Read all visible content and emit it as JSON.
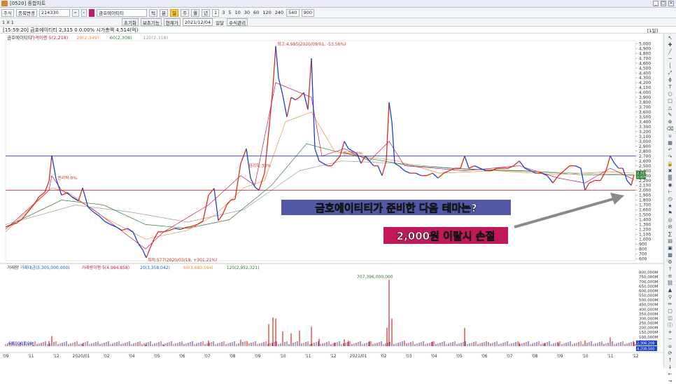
{
  "window": {
    "title": "[0520] 종합차트"
  },
  "toolbar1": {
    "market_sel": "주식",
    "sort_sel": "종목변경",
    "code": "214330",
    "stock_name": "금호에이티티",
    "period_tabs": [
      "틱",
      "분",
      "일",
      "주",
      "월",
      "년"
    ],
    "intervals": [
      "1",
      "3",
      "5",
      "10",
      "30",
      "60",
      "120",
      "240"
    ],
    "count_a": "540",
    "count_b": "900"
  },
  "toolbar2": {
    "ratio": "1 X 1",
    "btn_a": "초기화",
    "btn_b": "보조기능",
    "btn_c": "현재가",
    "date": "2021/12/04",
    "check_label": "일달",
    "btn_d": "수식관리"
  },
  "info": {
    "text": "[15:59:20] 금호에이티티 2,315   0 0.00% 시가총액 4,514(억)",
    "period": "[1일]"
  },
  "chart_data": {
    "type": "line",
    "title": "",
    "price_legend": [
      {
        "name": "금호에이티티",
        "color": "#333333"
      },
      {
        "name": "가격이평 5(2,218)",
        "color": "#c2185b"
      },
      {
        "name": "20(2,349)",
        "color": "#e69138"
      },
      {
        "name": "60(2,308)",
        "color": "#2e7d32"
      },
      {
        "name": "120(2,318)",
        "color": "#9e9e9e"
      }
    ],
    "volume_legend": [
      {
        "name": "거래량",
        "color": "#333333"
      },
      {
        "name": "거래대금(5,305,000,000)",
        "color": "#1565c0"
      },
      {
        "name": "거래량이평 5(4,994,858)",
        "color": "#c2185b"
      },
      {
        "name": "20(3,358,042)",
        "color": "#1565c0"
      },
      {
        "name": "60(3,680,594)",
        "color": "#e69138"
      },
      {
        "name": "120(2,952,321)",
        "color": "#2e7d32"
      }
    ],
    "y_ticks": [
      "5,000",
      "4,900",
      "4,800",
      "4,700",
      "4,600",
      "4,500",
      "4,400",
      "4,300",
      "4,200",
      "4,100",
      "4,000",
      "3,900",
      "3,800",
      "3,700",
      "3,600",
      "3,500",
      "3,400",
      "3,300",
      "3,200",
      "3,100",
      "3,000",
      "2,900",
      "2,800",
      "2,700",
      "2,600",
      "2,500",
      "2,400",
      "2,300",
      "2,200",
      "2,100",
      "2,000",
      "1,900",
      "1,800",
      "1,700",
      "1,600",
      "1,500",
      "1,400",
      "1,300",
      "1,200",
      "1,100",
      "1,000",
      "900",
      "800",
      "700",
      "600"
    ],
    "ylim": [
      560,
      5060
    ],
    "volume_ticks": [
      "800,000M",
      "750,000M",
      "700,000M",
      "650,000M",
      "600,000M",
      "550,000M",
      "500,000M",
      "450,000M",
      "400,000M",
      "350,000M",
      "300,000M",
      "250,000M",
      "200,000M",
      "150,000M",
      "100,000M",
      "50,000M"
    ],
    "x_labels": [
      "'09",
      "'11",
      "'12",
      "2020/01",
      "'02",
      "'04",
      "'05",
      "'06",
      "'07",
      "'08",
      "'09",
      "'10",
      "'11",
      "'12",
      "2021/01",
      "'02",
      "'03",
      "'04",
      "'05",
      "'06",
      "'07",
      "'08",
      "'09",
      "'10",
      "'11",
      "'12"
    ],
    "close_series": [
      [
        0,
        1250
      ],
      [
        8,
        1290
      ],
      [
        16,
        1330
      ],
      [
        24,
        1420
      ],
      [
        32,
        1560
      ],
      [
        40,
        1700
      ],
      [
        48,
        1870
      ],
      [
        56,
        1960
      ],
      [
        62,
        2180
      ],
      [
        66,
        2710
      ],
      [
        72,
        2240
      ],
      [
        80,
        1900
      ],
      [
        88,
        1950
      ],
      [
        96,
        1850
      ],
      [
        104,
        1780
      ],
      [
        110,
        2050
      ],
      [
        118,
        1650
      ],
      [
        126,
        1550
      ],
      [
        134,
        1470
      ],
      [
        142,
        1360
      ],
      [
        150,
        1300
      ],
      [
        158,
        1250
      ],
      [
        166,
        1180
      ],
      [
        174,
        1220
      ],
      [
        182,
        1150
      ],
      [
        190,
        900
      ],
      [
        196,
        780
      ],
      [
        201,
        620
      ],
      [
        206,
        800
      ],
      [
        212,
        1000
      ],
      [
        218,
        1150
      ],
      [
        226,
        1150
      ],
      [
        234,
        1180
      ],
      [
        242,
        1220
      ],
      [
        250,
        1200
      ],
      [
        258,
        1240
      ],
      [
        266,
        1260
      ],
      [
        274,
        1300
      ],
      [
        282,
        1370
      ],
      [
        290,
        1900
      ],
      [
        298,
        2040
      ],
      [
        304,
        1380
      ],
      [
        310,
        1500
      ],
      [
        316,
        1700
      ],
      [
        322,
        1800
      ],
      [
        328,
        1820
      ],
      [
        336,
        2550
      ],
      [
        344,
        2850
      ],
      [
        350,
        2250
      ],
      [
        356,
        2070
      ],
      [
        362,
        2000
      ],
      [
        370,
        2350
      ],
      [
        376,
        3200
      ],
      [
        382,
        4100
      ],
      [
        386,
        4950
      ],
      [
        390,
        4300
      ],
      [
        396,
        3950
      ],
      [
        402,
        3500
      ],
      [
        408,
        3900
      ],
      [
        414,
        3850
      ],
      [
        420,
        3900
      ],
      [
        426,
        4000
      ],
      [
        432,
        3650
      ],
      [
        437,
        4700
      ],
      [
        442,
        2850
      ],
      [
        448,
        2600
      ],
      [
        454,
        2550
      ],
      [
        460,
        2500
      ],
      [
        466,
        2500
      ],
      [
        472,
        2600
      ],
      [
        478,
        2700
      ],
      [
        484,
        3000
      ],
      [
        490,
        2850
      ],
      [
        496,
        2800
      ],
      [
        502,
        2750
      ],
      [
        508,
        2550
      ],
      [
        514,
        2700
      ],
      [
        520,
        2600
      ],
      [
        526,
        2500
      ],
      [
        532,
        2500
      ],
      [
        538,
        2300
      ],
      [
        544,
        2600
      ],
      [
        548,
        3800
      ],
      [
        552,
        3400
      ],
      [
        556,
        2550
      ],
      [
        562,
        2500
      ],
      [
        570,
        2400
      ],
      [
        578,
        2350
      ],
      [
        586,
        2350
      ],
      [
        594,
        2300
      ],
      [
        602,
        2300
      ],
      [
        610,
        2350
      ],
      [
        618,
        2250
      ],
      [
        626,
        2350
      ],
      [
        634,
        2400
      ],
      [
        642,
        2450
      ],
      [
        650,
        2450
      ],
      [
        656,
        2700
      ],
      [
        662,
        2450
      ],
      [
        670,
        2500
      ],
      [
        678,
        2450
      ],
      [
        686,
        2400
      ],
      [
        694,
        2400
      ],
      [
        702,
        2450
      ],
      [
        710,
        2450
      ],
      [
        718,
        2450
      ],
      [
        726,
        2500
      ],
      [
        734,
        2600
      ],
      [
        742,
        2450
      ],
      [
        750,
        2400
      ],
      [
        758,
        2350
      ],
      [
        766,
        2350
      ],
      [
        774,
        2300
      ],
      [
        782,
        2150
      ],
      [
        790,
        2300
      ],
      [
        798,
        2400
      ],
      [
        806,
        2500
      ],
      [
        814,
        2500
      ],
      [
        822,
        2450
      ],
      [
        828,
        2000
      ],
      [
        834,
        2150
      ],
      [
        842,
        2200
      ],
      [
        850,
        2200
      ],
      [
        858,
        2400
      ],
      [
        864,
        2700
      ],
      [
        870,
        2550
      ],
      [
        876,
        2450
      ],
      [
        882,
        2450
      ],
      [
        888,
        2200
      ],
      [
        894,
        2100
      ],
      [
        898,
        2315
      ]
    ],
    "overlay_ma5": [
      [
        0,
        1200
      ],
      [
        62,
        2000
      ],
      [
        66,
        2300
      ],
      [
        80,
        2000
      ],
      [
        126,
        1600
      ],
      [
        200,
        800
      ],
      [
        226,
        1150
      ],
      [
        290,
        1700
      ],
      [
        336,
        2300
      ],
      [
        356,
        2100
      ],
      [
        386,
        4200
      ],
      [
        437,
        3900
      ],
      [
        452,
        2700
      ],
      [
        484,
        2850
      ],
      [
        520,
        2600
      ],
      [
        548,
        3000
      ],
      [
        570,
        2500
      ],
      [
        656,
        2400
      ],
      [
        734,
        2500
      ],
      [
        790,
        2250
      ],
      [
        828,
        2150
      ],
      [
        864,
        2450
      ],
      [
        898,
        2218
      ]
    ],
    "overlay_ma20": [
      [
        0,
        1150
      ],
      [
        66,
        2050
      ],
      [
        90,
        1950
      ],
      [
        140,
        1450
      ],
      [
        200,
        1000
      ],
      [
        260,
        1180
      ],
      [
        300,
        1500
      ],
      [
        340,
        2050
      ],
      [
        370,
        2200
      ],
      [
        400,
        3400
      ],
      [
        437,
        3600
      ],
      [
        470,
        2800
      ],
      [
        510,
        2700
      ],
      [
        560,
        2600
      ],
      [
        620,
        2350
      ],
      [
        700,
        2400
      ],
      [
        790,
        2320
      ],
      [
        860,
        2380
      ],
      [
        898,
        2349
      ]
    ],
    "overlay_ma60": [
      [
        0,
        1250
      ],
      [
        80,
        1800
      ],
      [
        140,
        1700
      ],
      [
        200,
        1300
      ],
      [
        260,
        1220
      ],
      [
        320,
        1400
      ],
      [
        380,
        2100
      ],
      [
        430,
        2950
      ],
      [
        470,
        2800
      ],
      [
        520,
        2650
      ],
      [
        580,
        2500
      ],
      [
        660,
        2430
      ],
      [
        740,
        2400
      ],
      [
        820,
        2320
      ],
      [
        898,
        2308
      ]
    ],
    "overlay_ma120": [
      [
        0,
        1300
      ],
      [
        100,
        1700
      ],
      [
        180,
        1550
      ],
      [
        260,
        1350
      ],
      [
        340,
        1600
      ],
      [
        420,
        2400
      ],
      [
        480,
        2600
      ],
      [
        560,
        2550
      ],
      [
        640,
        2450
      ],
      [
        720,
        2400
      ],
      [
        820,
        2350
      ],
      [
        898,
        2318
      ]
    ],
    "hlines": [
      {
        "value": 2700,
        "color": "#2b3990"
      },
      {
        "value": 2000,
        "color": "#b22222"
      }
    ],
    "annotations": [
      {
        "text": "최고:4,985(2020/09/01, -53.56%)",
        "x": 386,
        "y": 4985
      },
      {
        "text": "최저:577(2020/03/19, +301.21%)",
        "x": 201,
        "y": 577
      },
      {
        "text": "권리락:0%",
        "x": 72,
        "y": 2250
      },
      {
        "text": "권리락:33%",
        "x": 345,
        "y": 2500
      },
      {
        "text": "권리락:0%",
        "x": 480,
        "y": 2750
      }
    ],
    "price_tag": {
      "value": "2,315",
      "sub": "0.00%"
    },
    "volume_bars": [
      [
        20,
        8
      ],
      [
        40,
        9
      ],
      [
        62,
        55
      ],
      [
        66,
        110
      ],
      [
        90,
        20
      ],
      [
        110,
        25
      ],
      [
        200,
        18
      ],
      [
        226,
        14
      ],
      [
        290,
        60
      ],
      [
        336,
        70
      ],
      [
        345,
        55
      ],
      [
        376,
        240
      ],
      [
        382,
        310
      ],
      [
        386,
        300
      ],
      [
        396,
        160
      ],
      [
        408,
        140
      ],
      [
        420,
        170
      ],
      [
        437,
        210
      ],
      [
        448,
        80
      ],
      [
        470,
        40
      ],
      [
        484,
        75
      ],
      [
        490,
        60
      ],
      [
        520,
        55
      ],
      [
        545,
        200
      ],
      [
        548,
        720
      ],
      [
        552,
        300
      ],
      [
        570,
        60
      ],
      [
        610,
        50
      ],
      [
        656,
        200
      ],
      [
        690,
        45
      ],
      [
        734,
        40
      ],
      [
        770,
        30
      ],
      [
        790,
        35
      ],
      [
        828,
        60
      ],
      [
        864,
        95
      ],
      [
        898,
        45
      ]
    ],
    "vol_max_label": "707,396,000,000",
    "vol_min_label": "68,000,000",
    "vol_tag_1": "2,306,208",
    "vol_tag_2": "4,208,500"
  },
  "overlay_text": {
    "line1": "금호에이티티가 준비한 다음 테마는?",
    "line2": "2,000원 이탈시 손절"
  },
  "right_panel": {
    "icons": [
      "arrow",
      "cross",
      "line",
      "hline",
      "vline",
      "trend",
      "fibo",
      "text",
      "circle",
      "rect",
      "tri",
      "pen",
      "zoom",
      "eraser",
      "magnet",
      "grid",
      "undo",
      "redo",
      "lock",
      "trash",
      "brush",
      "eye",
      "ruler",
      "clock",
      "star",
      "flag",
      "target",
      "note",
      "calc",
      "layer",
      "save",
      "print",
      "gear",
      "help",
      "list",
      "link",
      "chart",
      "pin",
      "pencil",
      "book",
      "box",
      "info",
      "plus",
      "minus",
      "home",
      "refresh",
      "up",
      "down",
      "left",
      "right"
    ]
  }
}
